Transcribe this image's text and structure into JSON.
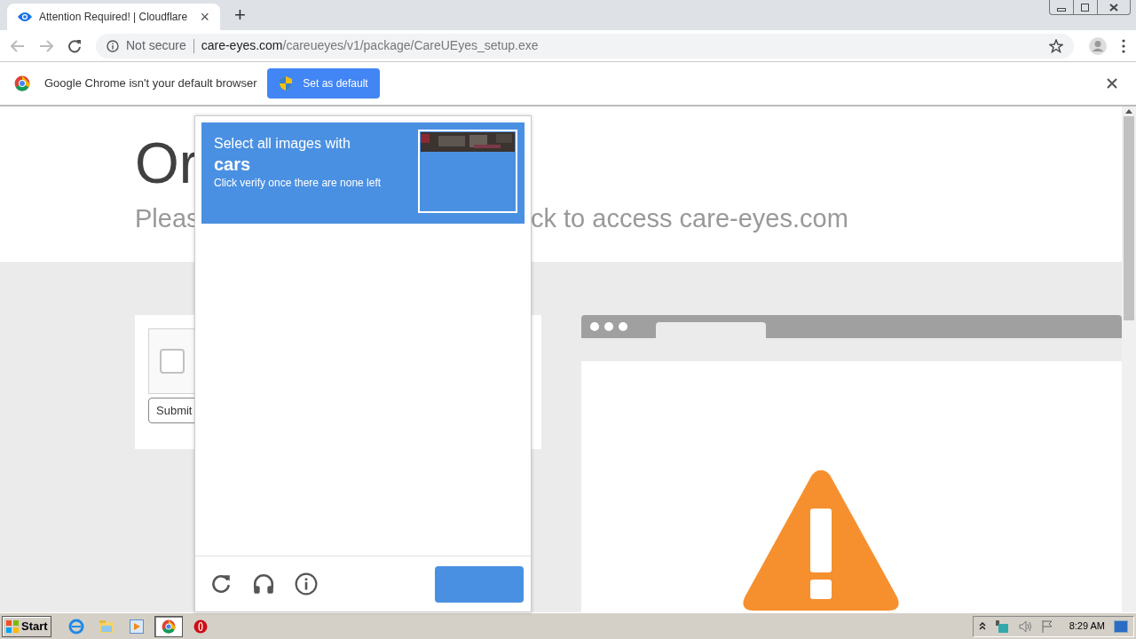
{
  "tab": {
    "title": "Attention Required! | Cloudflare",
    "close": "×"
  },
  "new_tab": "+",
  "address_bar": {
    "security": "Not secure",
    "host": "care-eyes.com",
    "path": "/careueyes/v1/package/CareUEyes_setup.exe"
  },
  "infobar": {
    "message": "Google Chrome isn't your default browser",
    "button": "Set as default"
  },
  "page": {
    "heading": "Or",
    "subtitle_left": "Pleas",
    "subtitle_right": "ck to access care-eyes.com",
    "checkbox": {
      "checked": false
    },
    "submit": "Submit"
  },
  "captcha": {
    "prompt": "Select all images with",
    "target": "cars",
    "hint": "Click verify once there are none left"
  },
  "taskbar": {
    "start": "Start",
    "items": [
      {
        "kind": "ie",
        "selected": false
      },
      {
        "kind": "explorer",
        "selected": false
      },
      {
        "kind": "media",
        "selected": false
      },
      {
        "kind": "chrome",
        "selected": true
      },
      {
        "kind": "opera",
        "selected": false
      }
    ],
    "clock": "8:29 AM"
  }
}
